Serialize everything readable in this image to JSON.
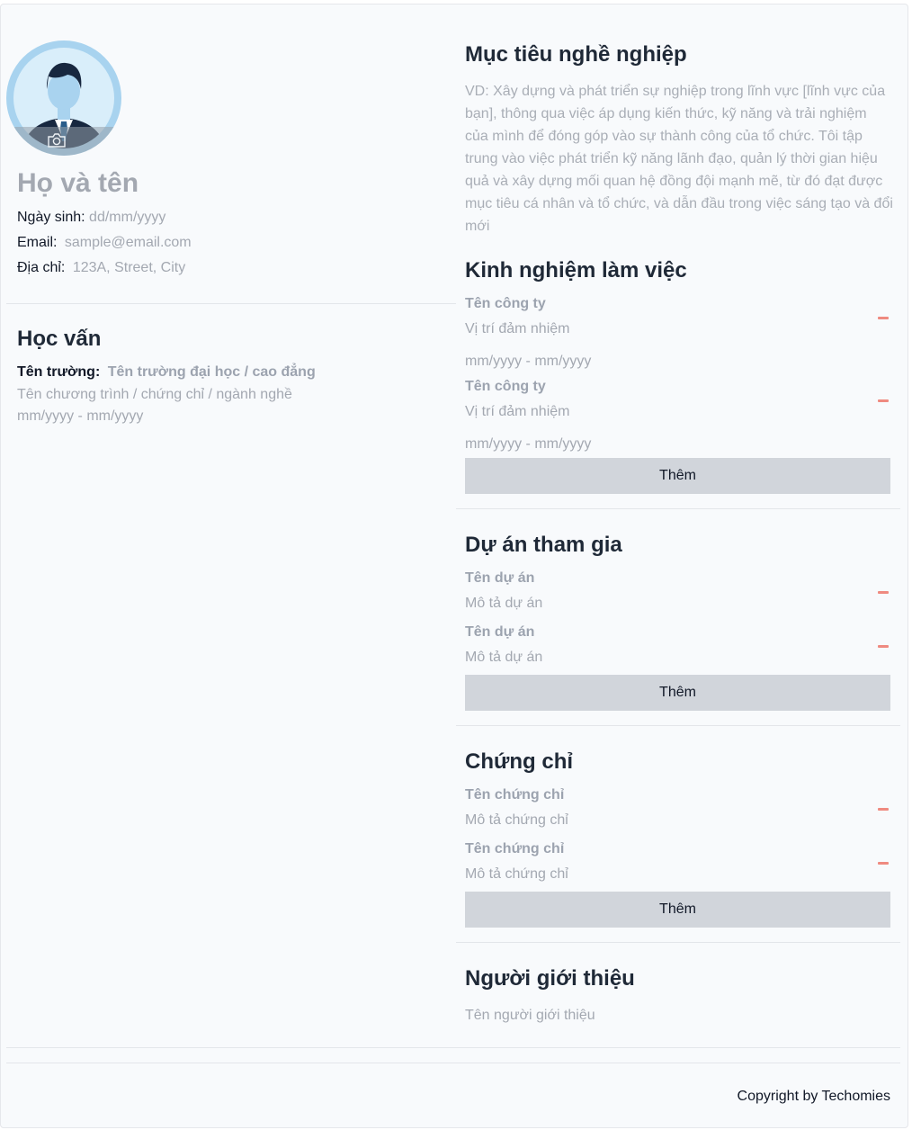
{
  "profile": {
    "name": "Họ và tên",
    "dob_label": "Ngày sinh:",
    "dob_value": "dd/mm/yyyy",
    "email_label": "Email:",
    "email_value": "sample@email.com",
    "address_label": "Địa chỉ:",
    "address_value": "123A, Street, City"
  },
  "education": {
    "title": "Học vấn",
    "school_label": "Tên trường:",
    "school_value": "Tên trường đại học / cao đẳng",
    "program": "Tên chương trình / chứng chỉ / ngành nghề",
    "period": "mm/yyyy - mm/yyyy"
  },
  "objective": {
    "title": "Mục tiêu nghề nghiệp",
    "text": "VD: Xây dựng và phát triển sự nghiệp trong lĩnh vực [lĩnh vực của bạn], thông qua việc áp dụng kiến thức, kỹ năng và trải nghiệm của mình để đóng góp vào sự thành công của tổ chức. Tôi tập trung vào việc phát triển kỹ năng lãnh đạo, quản lý thời gian hiệu quả và xây dựng mối quan hệ đồng đội mạnh mẽ, từ đó đạt được mục tiêu cá nhân và tổ chức, và dẫn đầu trong việc sáng tạo và đổi mới"
  },
  "experience": {
    "title": "Kinh nghiệm làm việc",
    "items": [
      {
        "company": "Tên công ty",
        "position": "Vị trí đảm nhiệm",
        "period": "mm/yyyy - mm/yyyy"
      },
      {
        "company": "Tên công ty",
        "position": "Vị trí đảm nhiệm",
        "period": "mm/yyyy - mm/yyyy"
      }
    ],
    "add_label": "Thêm"
  },
  "projects": {
    "title": "Dự án tham gia",
    "items": [
      {
        "name": "Tên dự án",
        "desc": "Mô tả dự án"
      },
      {
        "name": "Tên dự án",
        "desc": "Mô tả dự án"
      }
    ],
    "add_label": "Thêm"
  },
  "certificates": {
    "title": "Chứng chỉ",
    "items": [
      {
        "name": "Tên chứng chỉ",
        "desc": "Mô tả chứng chỉ"
      },
      {
        "name": "Tên chứng chỉ",
        "desc": "Mô tả chứng chỉ"
      }
    ],
    "add_label": "Thêm"
  },
  "referee": {
    "title": "Người giới thiệu",
    "name": "Tên người giới thiệu"
  },
  "footer": {
    "copyright": "Copyright by Techomies"
  },
  "icons": {
    "avatar": "user-avatar-icon",
    "camera": "camera-icon",
    "remove": "minus-icon"
  },
  "colors": {
    "page_bg": "#f8fafc",
    "placeholder": "#a3a8b1",
    "heading": "#1f2937",
    "remove": "#ef8a80",
    "button_bg": "#d1d5db"
  }
}
